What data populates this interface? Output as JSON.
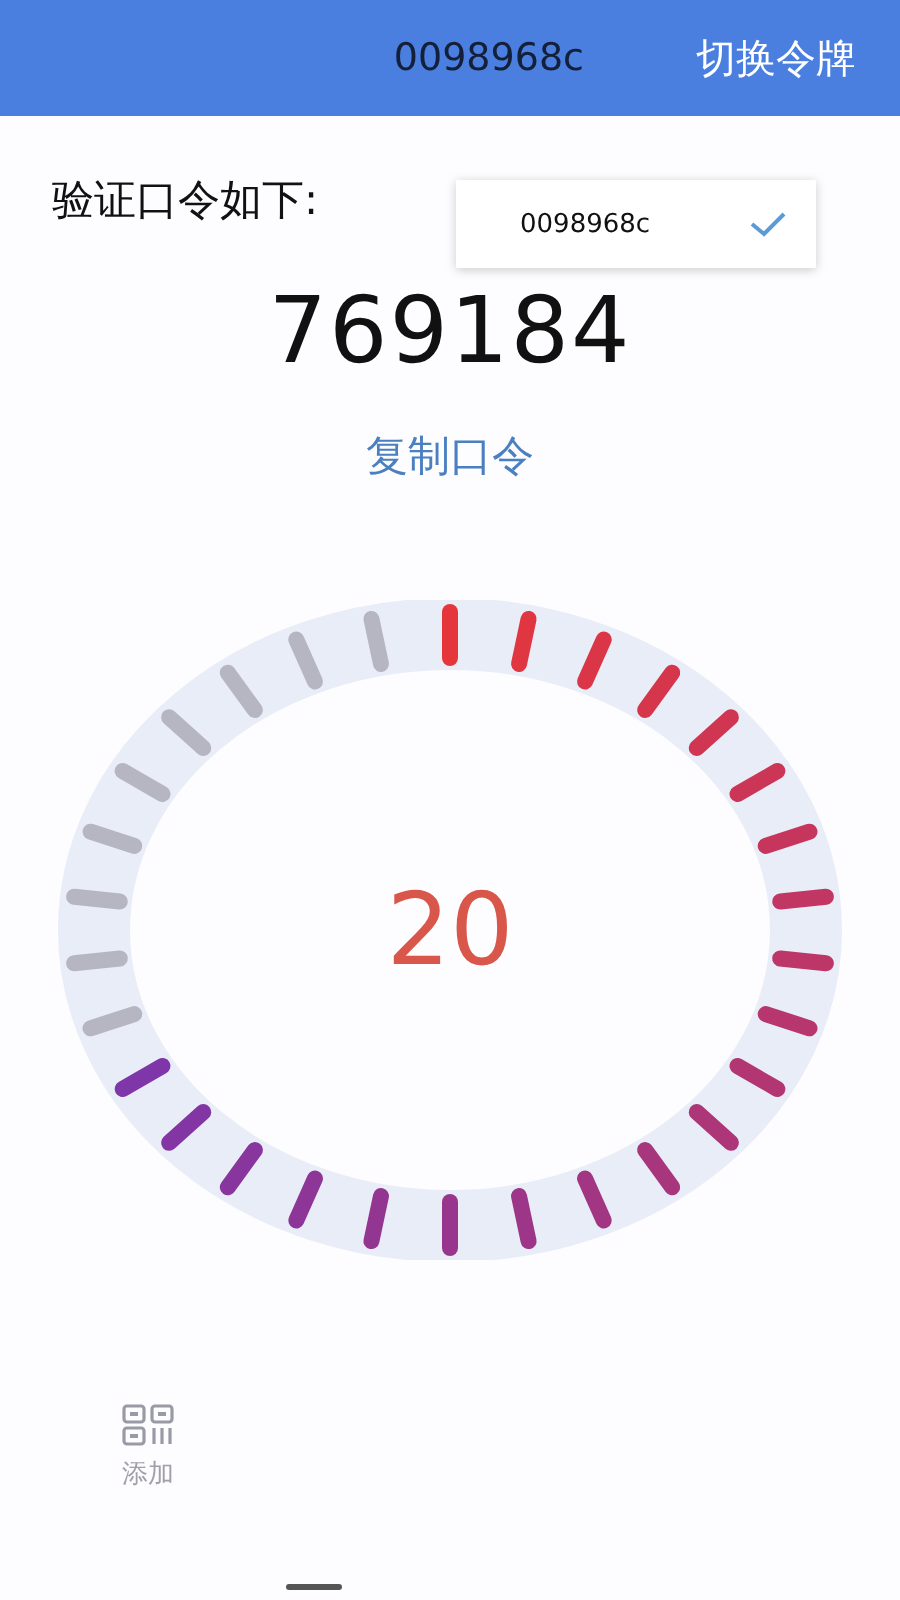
{
  "header": {
    "title": "0098968c",
    "action": "切换令牌"
  },
  "prompt": "验证口令如下:",
  "token_menu": [
    {
      "label": "0098968c",
      "selected": true
    }
  ],
  "code": "769184",
  "copy_link": "复制口令",
  "timer": {
    "seconds": "20",
    "level": 0.7
  },
  "bottom_nav": [
    {
      "label": "添加",
      "kind": "qr"
    }
  ]
}
